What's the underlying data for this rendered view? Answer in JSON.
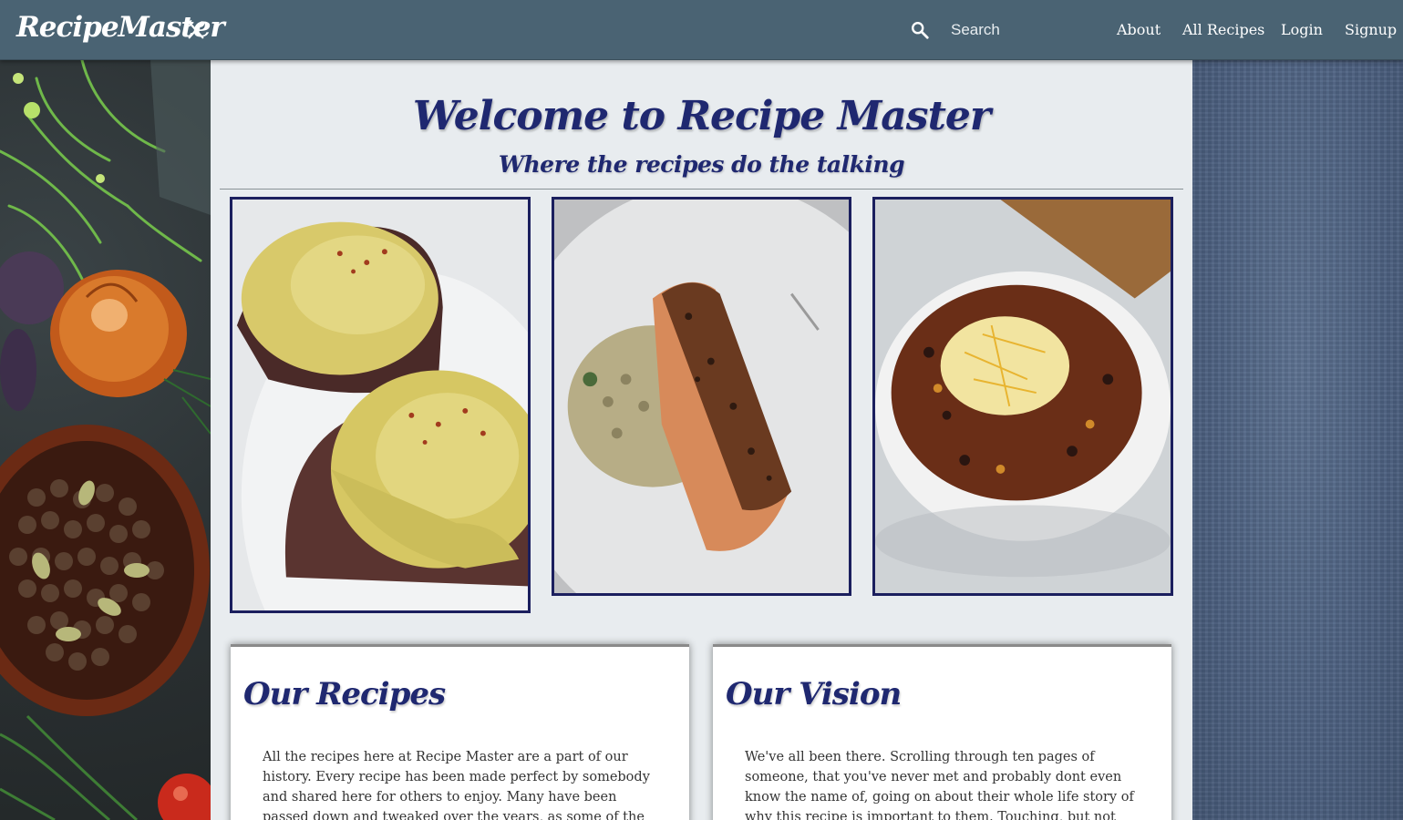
{
  "nav": {
    "brand": "RecipeMaster",
    "brand_icon": "utensils-crossed-icon",
    "search_icon": "search-icon",
    "search_placeholder": "Search",
    "links": [
      "About",
      "All Recipes",
      "Login",
      "Signup"
    ]
  },
  "hero": {
    "title": "Welcome to Recipe Master",
    "subtitle": "Where the recipes do the talking"
  },
  "photos": [
    {
      "subject": "eggs-benedict-photo"
    },
    {
      "subject": "salmon-risotto-photo"
    },
    {
      "subject": "chili-bowl-photo"
    }
  ],
  "cards": [
    {
      "title": "Our Recipes",
      "text": "All the recipes here at Recipe Master are a part of our history. Every recipe has been made perfect by somebody and shared here for others to enjoy. Many have been passed down and tweaked over the years, as some of the best recipes are. Share"
    },
    {
      "title": "Our Vision",
      "text": "We've all been there. Scrolling through ten pages of someone, that you've never met and probably dont even know the name of, going on about their whole life story of why this recipe is important to them. Touching, but not what you were"
    }
  ],
  "colors": {
    "navbar": "#4a6373",
    "heading": "#1f2870",
    "photo_border": "#1b1f5e",
    "main_bg": "#e8ecef"
  }
}
